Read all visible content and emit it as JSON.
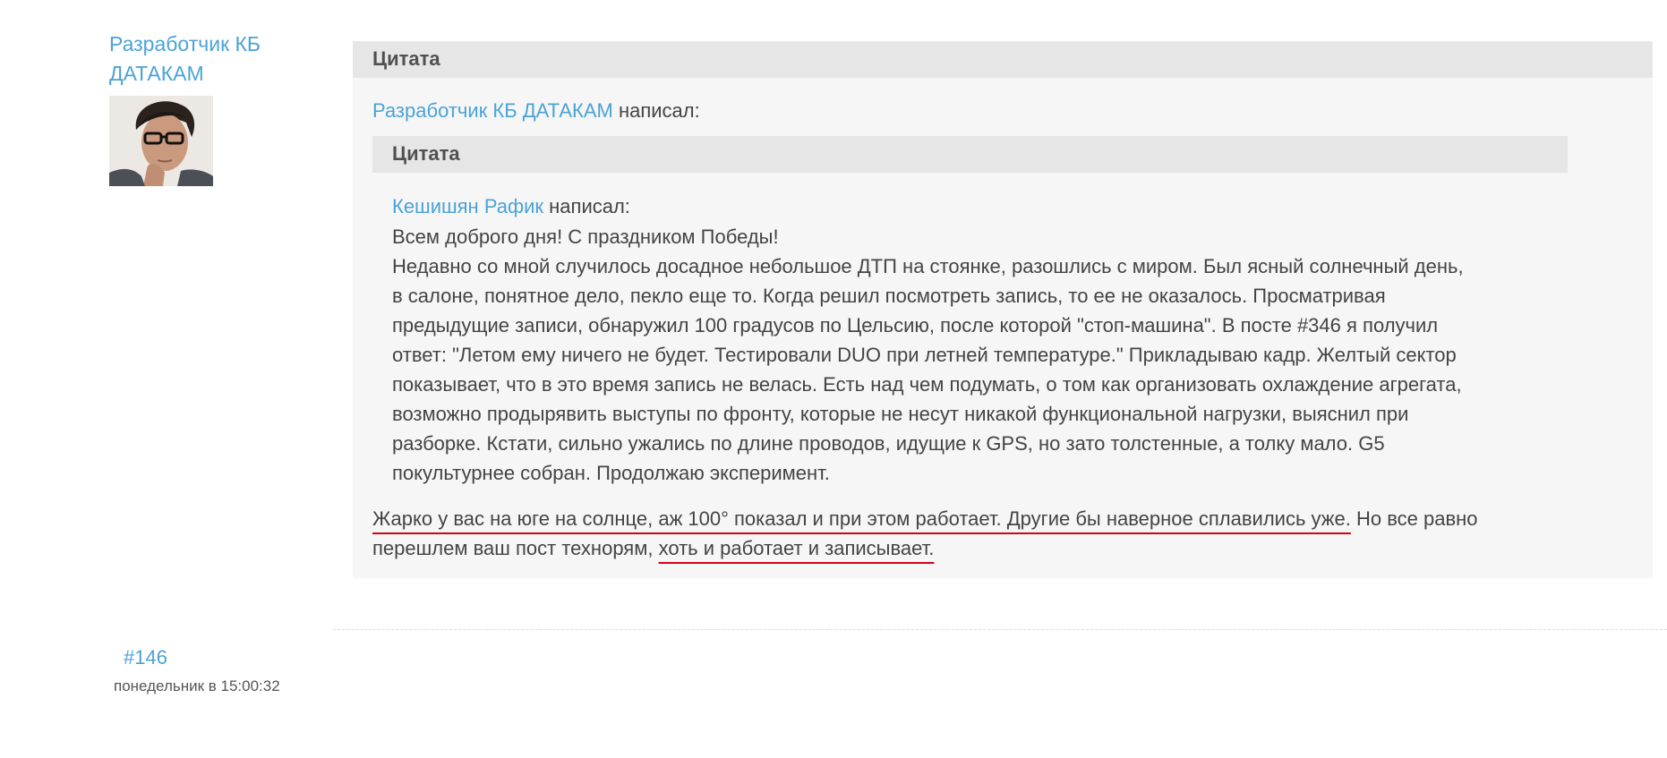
{
  "author": {
    "name_line1": "Разработчик КБ",
    "name_line2": "ДАТАКАМ"
  },
  "outer_quote": {
    "header": "Цитата",
    "author": "Разработчик КБ ДАТАКАМ",
    "wrote": "написал:"
  },
  "inner_quote": {
    "header": "Цитата",
    "author": "Кешишян Рафик",
    "wrote": "написал:",
    "lines": [
      "Всем доброго дня! С праздником Победы!",
      "Недавно со мной случилось досадное небольшое ДТП на стоянке, разошлись с миром. Был ясный солнечный день,",
      "в салоне, понятное дело, пекло еще то. Когда решил посмотреть запись, то ее не оказалось. Просматривая",
      "предыдущие записи, обнаружил 100 градусов по Цельсию, после которой \"стоп-машина\". В посте #346 я получил",
      "ответ: \"Летом ему ничего не будет. Тестировали DUO при летней температуре.\" Прикладываю кадр. Желтый сектор",
      "показывает, что в это время запись не велась. Есть над чем подумать, о том как организовать охлаждение агрегата,",
      "возможно продырявить выступы по фронту, которые не несут никакой функциональной нагрузки, выяснил при",
      "разборке. Кстати, сильно ужались по длине проводов, идущие к GPS, но зато толстенные, а толку мало. G5",
      "покультурнее собран. Продолжаю эксперимент."
    ]
  },
  "reply": {
    "line1_underlined": "Жарко у вас на юге на солнце, аж 100° показал и при этом работает. Другие бы наверное сплавились уже.",
    "line1_rest": " Но все равно",
    "line2_start": "перешлем ваш пост технорям, ",
    "line2_underlined": "хоть и работает и записывает."
  },
  "post": {
    "number": "#146",
    "time": "понедельник в 15:00:32"
  },
  "colors": {
    "link": "#4ba3d6",
    "quote_bg": "#f6f6f6",
    "quote_header_bg": "#e6e6e6",
    "underline": "#d0021b"
  }
}
